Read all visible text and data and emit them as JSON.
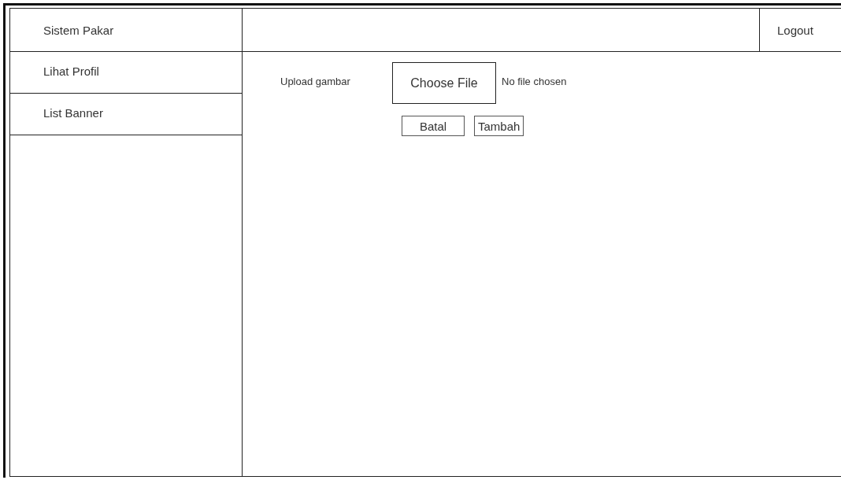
{
  "app": {
    "title": "Sistem Pakar"
  },
  "header": {
    "logout": "Logout"
  },
  "sidebar": {
    "items": [
      {
        "label": "Lihat Profil"
      },
      {
        "label": "List Banner"
      }
    ]
  },
  "form": {
    "label": "Upload gambar",
    "file_button": "Choose File",
    "file_status": "No file chosen"
  },
  "buttons": [
    "Batal",
    "Tambah"
  ]
}
